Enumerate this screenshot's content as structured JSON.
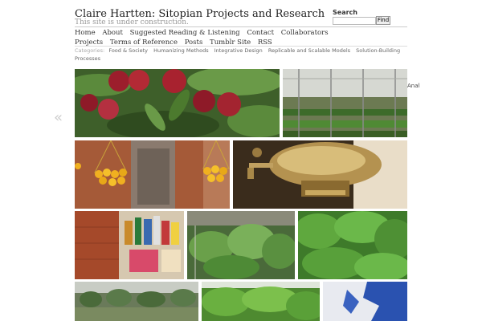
{
  "header": {
    "title": "Claire Hartten: Sitopian Projects and Research",
    "tagline": "This site is under construction."
  },
  "search": {
    "label": "Search",
    "value": "",
    "button": "Find"
  },
  "nav": {
    "items": [
      "Home",
      "About",
      "Suggested Reading & Listening",
      "Contact",
      "Collaborators",
      "Projects",
      "Terms of Reference",
      "Posts",
      "Tumblr Site",
      "RSS"
    ]
  },
  "categories": {
    "label": "Categories:",
    "items": [
      "Food & Society",
      "Humanizing Methods",
      "Integrative Design",
      "Replicable and Scalable Models",
      "Solution-Building Processes"
    ]
  },
  "gallery": {
    "prev_icon": "«",
    "side_caption": "Anal"
  },
  "colors": {
    "leaf": "#4c7a2e",
    "apple": "#9c1e2c",
    "brick": "#a55a38"
  }
}
